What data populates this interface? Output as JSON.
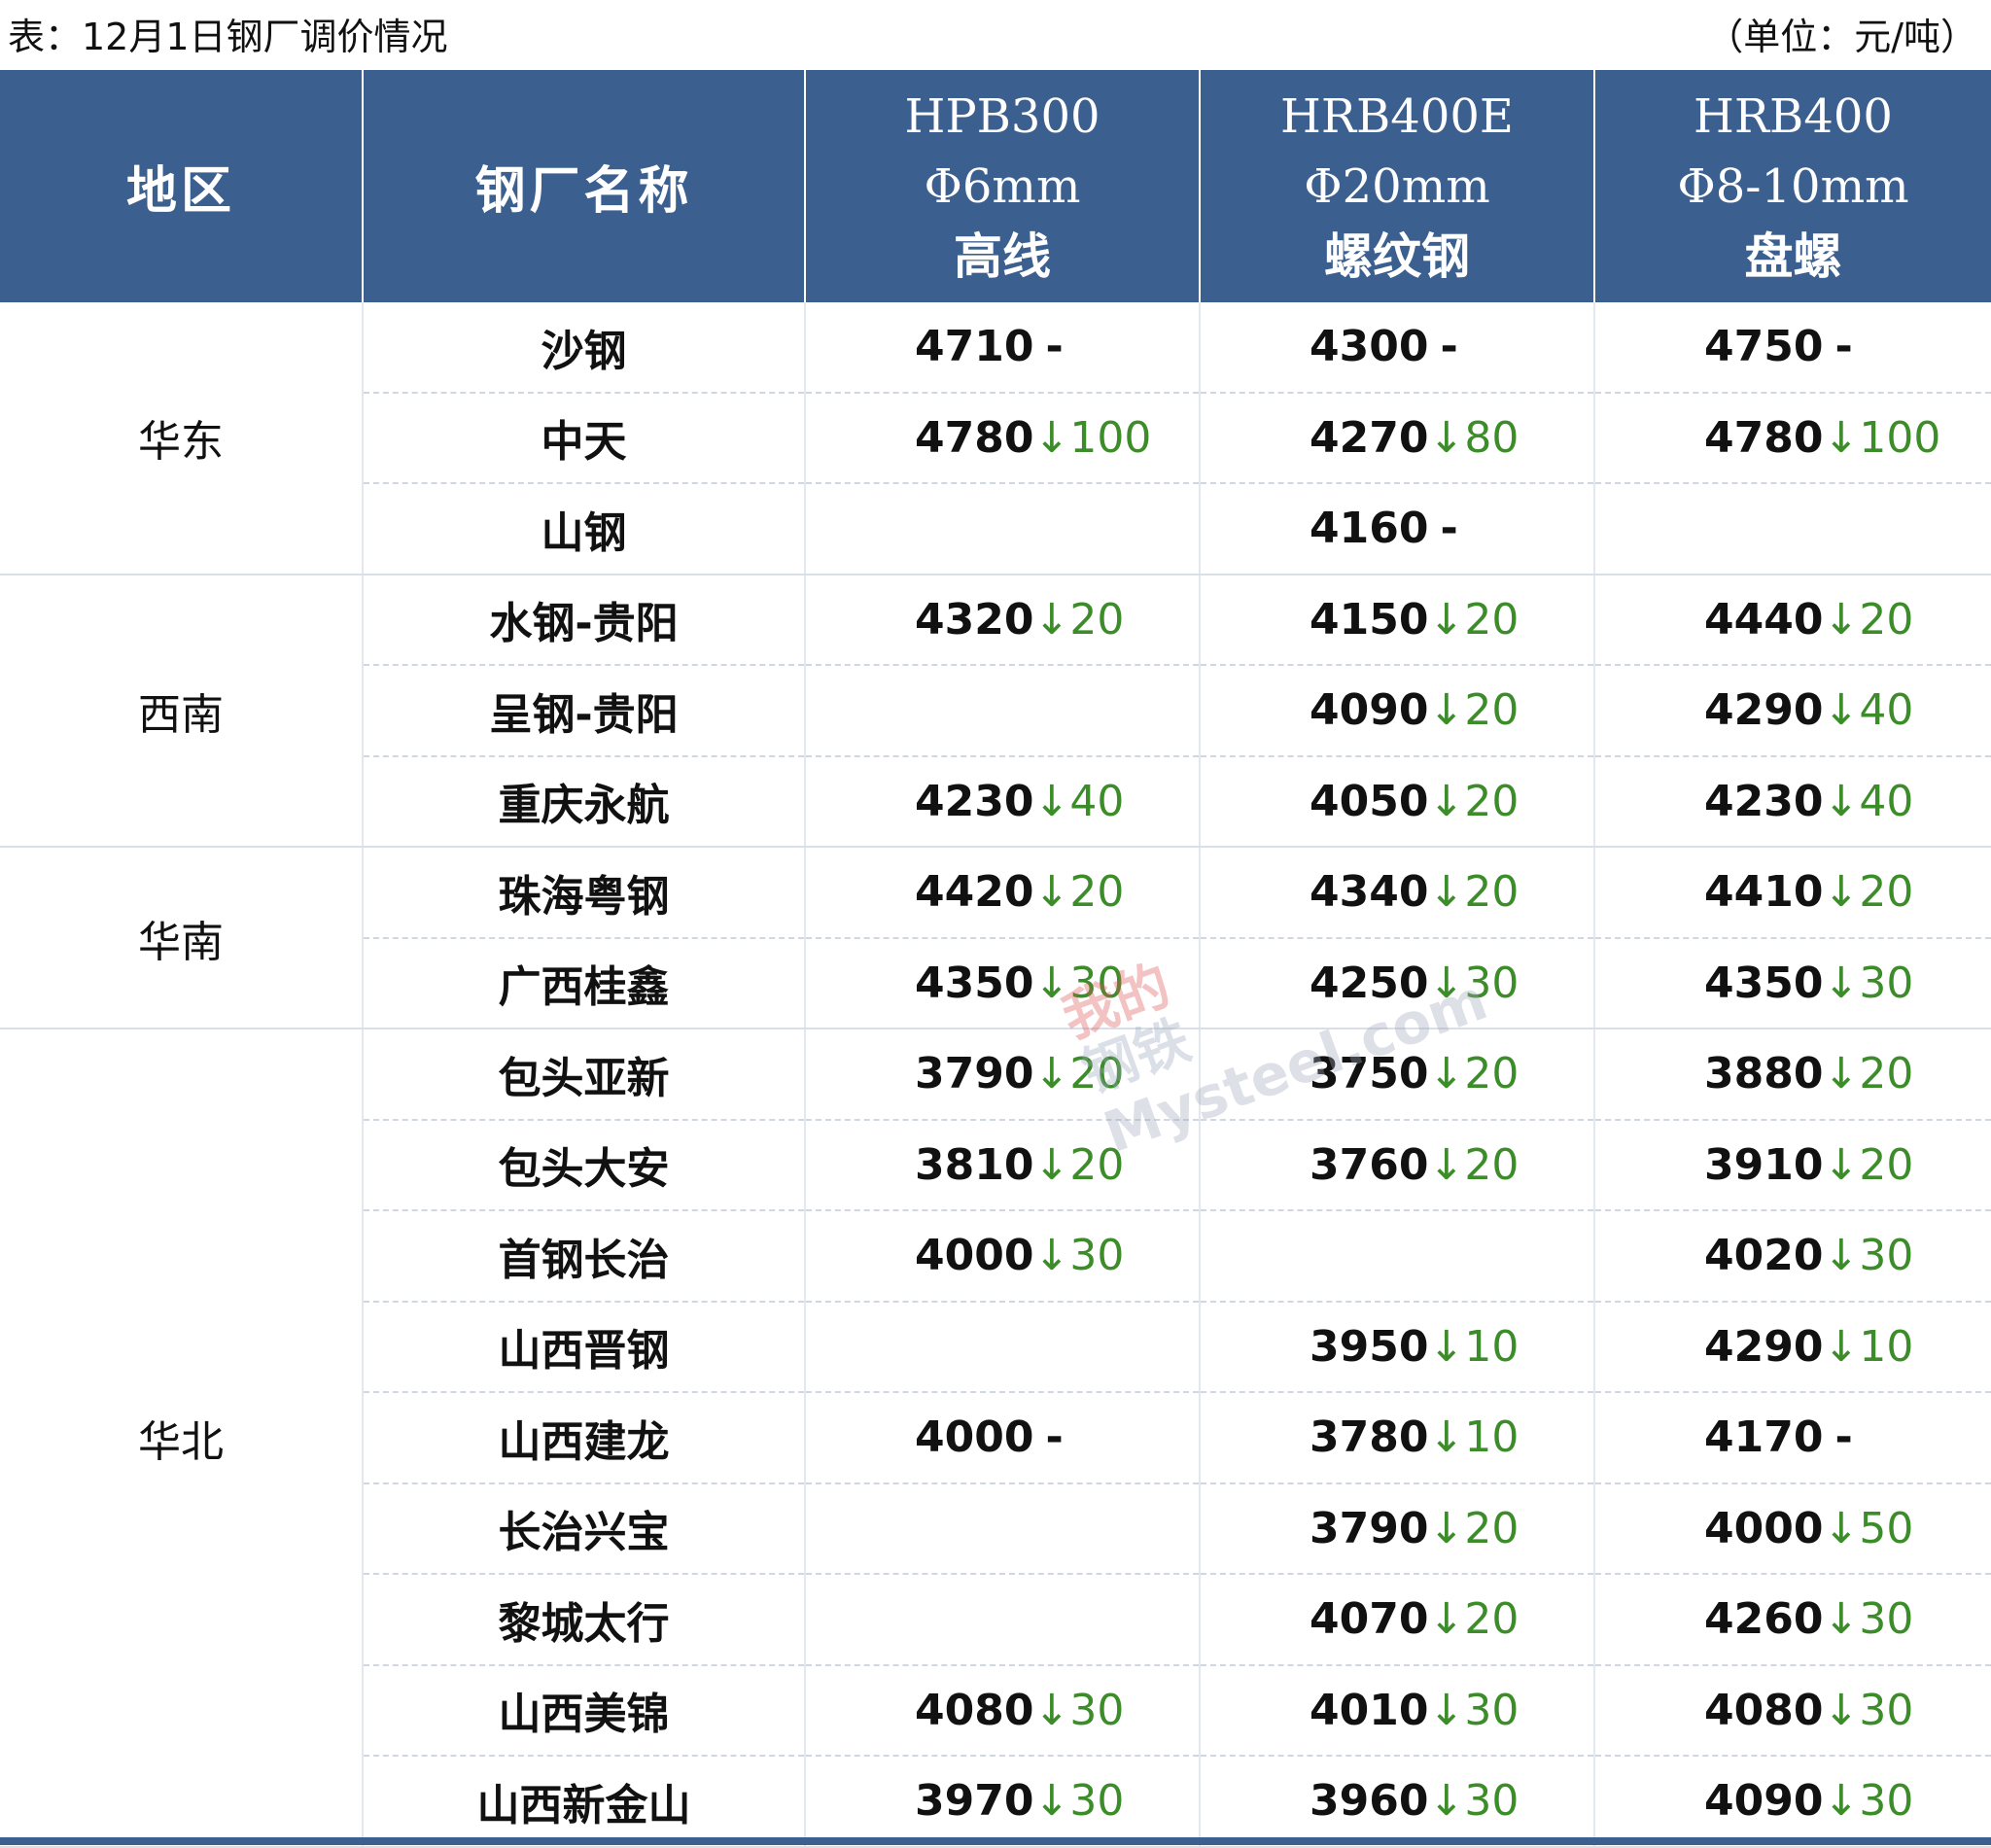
{
  "caption": "表：12月1日钢厂调价情况",
  "unit": "（单位：元/吨）",
  "header": {
    "region": "地区",
    "mill": "钢厂名称",
    "products": [
      {
        "grade": "HPB300",
        "size": "Φ6mm",
        "type": "高线"
      },
      {
        "grade": "HRB400E",
        "size": "Φ20mm",
        "type": "螺纹钢"
      },
      {
        "grade": "HRB400",
        "size": "Φ8-10mm",
        "type": "盘螺"
      }
    ]
  },
  "watermark": {
    "cn_top": "我的",
    "cn_bottom": "钢铁",
    "en": "Mysteel.com"
  },
  "colors": {
    "header_bg": "#3b5f8e",
    "down": "#3c8c2a"
  },
  "groups": [
    {
      "region": "华东",
      "rows": [
        {
          "mill": "沙钢",
          "cells": [
            {
              "price": "4710",
              "change": "-"
            },
            {
              "price": "4300",
              "change": "-"
            },
            {
              "price": "4750",
              "change": "-"
            }
          ]
        },
        {
          "mill": "中天",
          "cells": [
            {
              "price": "4780",
              "change": "↓100"
            },
            {
              "price": "4270",
              "change": "↓80"
            },
            {
              "price": "4780",
              "change": "↓100"
            }
          ]
        },
        {
          "mill": "山钢",
          "cells": [
            {
              "price": "",
              "change": ""
            },
            {
              "price": "4160",
              "change": "-"
            },
            {
              "price": "",
              "change": ""
            }
          ]
        }
      ]
    },
    {
      "region": "西南",
      "rows": [
        {
          "mill": "水钢-贵阳",
          "cells": [
            {
              "price": "4320",
              "change": "↓20"
            },
            {
              "price": "4150",
              "change": "↓20"
            },
            {
              "price": "4440",
              "change": "↓20"
            }
          ]
        },
        {
          "mill": "呈钢-贵阳",
          "cells": [
            {
              "price": "",
              "change": ""
            },
            {
              "price": "4090",
              "change": "↓20"
            },
            {
              "price": "4290",
              "change": "↓40"
            }
          ]
        },
        {
          "mill": "重庆永航",
          "cells": [
            {
              "price": "4230",
              "change": "↓40"
            },
            {
              "price": "4050",
              "change": "↓20"
            },
            {
              "price": "4230",
              "change": "↓40"
            }
          ]
        }
      ]
    },
    {
      "region": "华南",
      "rows": [
        {
          "mill": "珠海粤钢",
          "cells": [
            {
              "price": "4420",
              "change": "↓20"
            },
            {
              "price": "4340",
              "change": "↓20"
            },
            {
              "price": "4410",
              "change": "↓20"
            }
          ]
        },
        {
          "mill": "广西桂鑫",
          "cells": [
            {
              "price": "4350",
              "change": "↓30"
            },
            {
              "price": "4250",
              "change": "↓30"
            },
            {
              "price": "4350",
              "change": "↓30"
            }
          ]
        }
      ]
    },
    {
      "region": "华北",
      "rows": [
        {
          "mill": "包头亚新",
          "cells": [
            {
              "price": "3790",
              "change": "↓20"
            },
            {
              "price": "3750",
              "change": "↓20"
            },
            {
              "price": "3880",
              "change": "↓20"
            }
          ]
        },
        {
          "mill": "包头大安",
          "cells": [
            {
              "price": "3810",
              "change": "↓20"
            },
            {
              "price": "3760",
              "change": "↓20"
            },
            {
              "price": "3910",
              "change": "↓20"
            }
          ]
        },
        {
          "mill": "首钢长治",
          "cells": [
            {
              "price": "4000",
              "change": "↓30"
            },
            {
              "price": "",
              "change": ""
            },
            {
              "price": "4020",
              "change": "↓30"
            }
          ]
        },
        {
          "mill": "山西晋钢",
          "cells": [
            {
              "price": "",
              "change": ""
            },
            {
              "price": "3950",
              "change": "↓10"
            },
            {
              "price": "4290",
              "change": "↓10"
            }
          ]
        },
        {
          "mill": "山西建龙",
          "cells": [
            {
              "price": "4000",
              "change": "-"
            },
            {
              "price": "3780",
              "change": "↓10"
            },
            {
              "price": "4170",
              "change": "-"
            }
          ]
        },
        {
          "mill": "长治兴宝",
          "cells": [
            {
              "price": "",
              "change": ""
            },
            {
              "price": "3790",
              "change": "↓20"
            },
            {
              "price": "4000",
              "change": "↓50"
            }
          ]
        },
        {
          "mill": "黎城太行",
          "cells": [
            {
              "price": "",
              "change": ""
            },
            {
              "price": "4070",
              "change": "↓20"
            },
            {
              "price": "4260",
              "change": "↓30"
            }
          ]
        },
        {
          "mill": "山西美锦",
          "cells": [
            {
              "price": "4080",
              "change": "↓30"
            },
            {
              "price": "4010",
              "change": "↓30"
            },
            {
              "price": "4080",
              "change": "↓30"
            }
          ]
        },
        {
          "mill": "山西新金山",
          "cells": [
            {
              "price": "3970",
              "change": "↓30"
            },
            {
              "price": "3960",
              "change": "↓30"
            },
            {
              "price": "4090",
              "change": "↓30"
            }
          ]
        }
      ]
    }
  ]
}
